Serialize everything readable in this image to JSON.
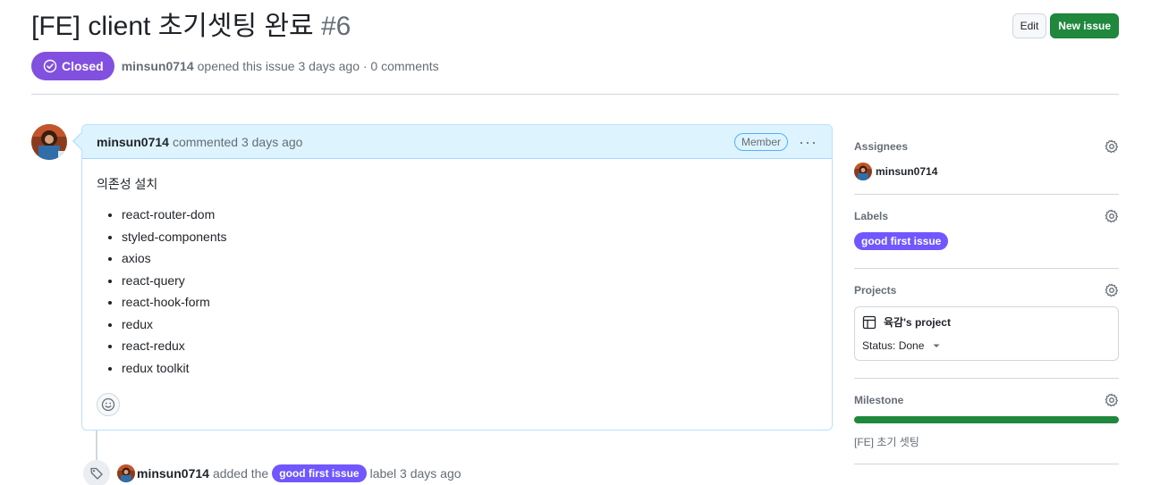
{
  "issue": {
    "title": "[FE] client 초기셋팅 완료",
    "number": "#6",
    "state": "Closed",
    "author": "minsun0714",
    "opened_text": "opened this issue 3 days ago · 0 comments"
  },
  "actions": {
    "edit_label": "Edit",
    "new_issue_label": "New issue"
  },
  "comment": {
    "author": "minsun0714",
    "meta": "commented 3 days ago",
    "badge": "Member",
    "heading": "의존성 설치",
    "items": [
      "react-router-dom",
      "styled-components",
      "axios",
      "react-query",
      "react-hook-form",
      "redux",
      "react-redux",
      "redux toolkit"
    ]
  },
  "event": {
    "author": "minsun0714",
    "text_before": "added the",
    "label": "good first issue",
    "text_after": "label 3 days ago"
  },
  "sidebar": {
    "assignees": {
      "heading": "Assignees",
      "user": "minsun0714"
    },
    "labels": {
      "heading": "Labels",
      "label": "good first issue"
    },
    "projects": {
      "heading": "Projects",
      "name": "육감's project",
      "status": "Status: Done"
    },
    "milestone": {
      "heading": "Milestone",
      "name": "[FE] 초기 셋팅",
      "progress": 1.0
    }
  },
  "colors": {
    "closed": "#8250df",
    "label": "#7057ff",
    "primary": "#1f883d"
  }
}
